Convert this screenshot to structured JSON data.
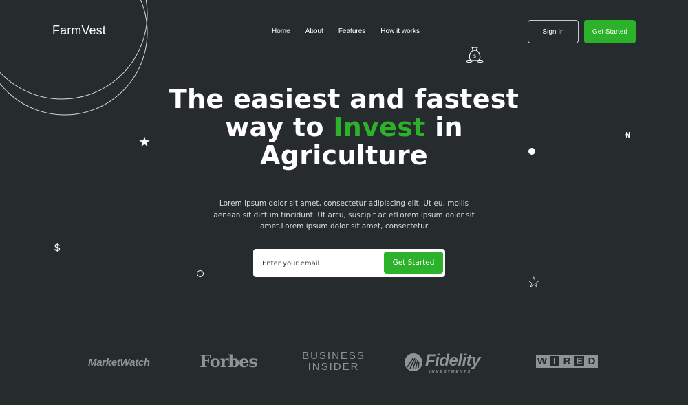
{
  "colors": {
    "background": "#262b2e",
    "accent": "#2bb12a",
    "text": "#ffffff",
    "brand_logo": "#8f9496"
  },
  "header": {
    "logo": "FarmVest",
    "nav": [
      "Home",
      "About",
      "Features",
      "How it works"
    ],
    "sign_in_label": "Sign In",
    "get_started_label": "Get Started"
  },
  "hero": {
    "title_line1": "The easiest and fastest",
    "title_line2_pre": "way to",
    "title_accent": "Invest",
    "title_line2_post": "in",
    "title_line3": "Agriculture",
    "subtitle": "Lorem ipsum dolor sit amet, consectetur adipiscing elit. Ut eu, mollis aenean sit dictum tincidunt. Ut arcu, suscipit ac etLorem ipsum dolor sit amet.Lorem ipsum dolor sit amet, consectetur",
    "email_placeholder": "Enter your email",
    "cta_label": "Get Started"
  },
  "decorations": {
    "dollar": "$",
    "naira": "₦",
    "star_solid": "★",
    "star_outline": "☆",
    "icons": [
      "money-bag-icon",
      "star-icon",
      "star-outline-icon",
      "dollar-icon",
      "naira-icon",
      "dot-icon",
      "ring-icon"
    ]
  },
  "brands": {
    "marketwatch": "MarketWatch",
    "forbes": "Forbes",
    "business_insider_line1": "BUSINESS",
    "business_insider_line2": "INSIDER",
    "fidelity": "Fidelity",
    "fidelity_sub": "INVESTMENTS",
    "wired_letters": [
      "W",
      "I",
      "R",
      "E",
      "D"
    ]
  }
}
